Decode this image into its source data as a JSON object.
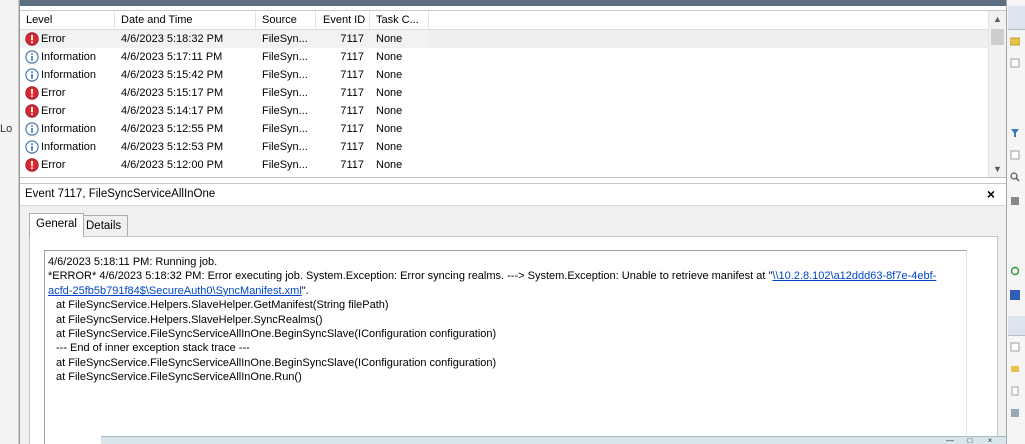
{
  "left_pane": {
    "truncated_label": "Lo"
  },
  "event_list": {
    "columns": [
      "Level",
      "Date and Time",
      "Source",
      "Event ID",
      "Task C..."
    ],
    "rows": [
      {
        "level": "Error",
        "icon": "error-icon",
        "date": "4/6/2023 5:18:32 PM",
        "source": "FileSyn...",
        "event_id": "7117",
        "task": "None",
        "selected": true
      },
      {
        "level": "Information",
        "icon": "info-icon",
        "date": "4/6/2023 5:17:11 PM",
        "source": "FileSyn...",
        "event_id": "7117",
        "task": "None"
      },
      {
        "level": "Information",
        "icon": "info-icon",
        "date": "4/6/2023 5:15:42 PM",
        "source": "FileSyn...",
        "event_id": "7117",
        "task": "None"
      },
      {
        "level": "Error",
        "icon": "error-icon",
        "date": "4/6/2023 5:15:17 PM",
        "source": "FileSyn...",
        "event_id": "7117",
        "task": "None"
      },
      {
        "level": "Error",
        "icon": "error-icon",
        "date": "4/6/2023 5:14:17 PM",
        "source": "FileSyn...",
        "event_id": "7117",
        "task": "None"
      },
      {
        "level": "Information",
        "icon": "info-icon",
        "date": "4/6/2023 5:12:55 PM",
        "source": "FileSyn...",
        "event_id": "7117",
        "task": "None"
      },
      {
        "level": "Information",
        "icon": "info-icon",
        "date": "4/6/2023 5:12:53 PM",
        "source": "FileSyn...",
        "event_id": "7117",
        "task": "None"
      },
      {
        "level": "Error",
        "icon": "error-icon",
        "date": "4/6/2023 5:12:00 PM",
        "source": "FileSyn...",
        "event_id": "7117",
        "task": "None"
      }
    ]
  },
  "details": {
    "title": "Event 7117, FileSyncServiceAllInOne",
    "close_glyph": "×",
    "tabs": [
      {
        "label": "General",
        "active": true
      },
      {
        "label": "Details",
        "active": false
      }
    ],
    "message": {
      "line1": "4/6/2023 5:18:11 PM: Running job.",
      "line2_prefix": "*ERROR* 4/6/2023 5:18:32 PM: Error executing job. System.Exception: Error syncing realms. ---> System.Exception: Unable to retrieve manifest at \"",
      "link_part1": "\\\\10.2.8.102\\a12ddd63-8f7e-4ebf-",
      "link_part2": "acfd-25fb5b791f84$\\SecureAuth0\\SyncManifest.xml",
      "line3_suffix": "\".",
      "stack": [
        "at FileSyncService.Helpers.SlaveHelper.GetManifest(String filePath)",
        "at FileSyncService.Helpers.SlaveHelper.SyncRealms()",
        "at FileSyncService.FileSyncServiceAllInOne.BeginSyncSlave(IConfiguration configuration)",
        "--- End of inner exception stack trace ---",
        "at FileSyncService.FileSyncServiceAllInOne.BeginSyncSlave(IConfiguration configuration)",
        "at FileSyncService.FileSyncServiceAllInOne.Run()"
      ]
    }
  },
  "colors": {
    "error_red": "#d8292f",
    "info_blue": "#3a6ea5",
    "link_blue": "#0047c8",
    "title_strip": "#5f6f82"
  }
}
